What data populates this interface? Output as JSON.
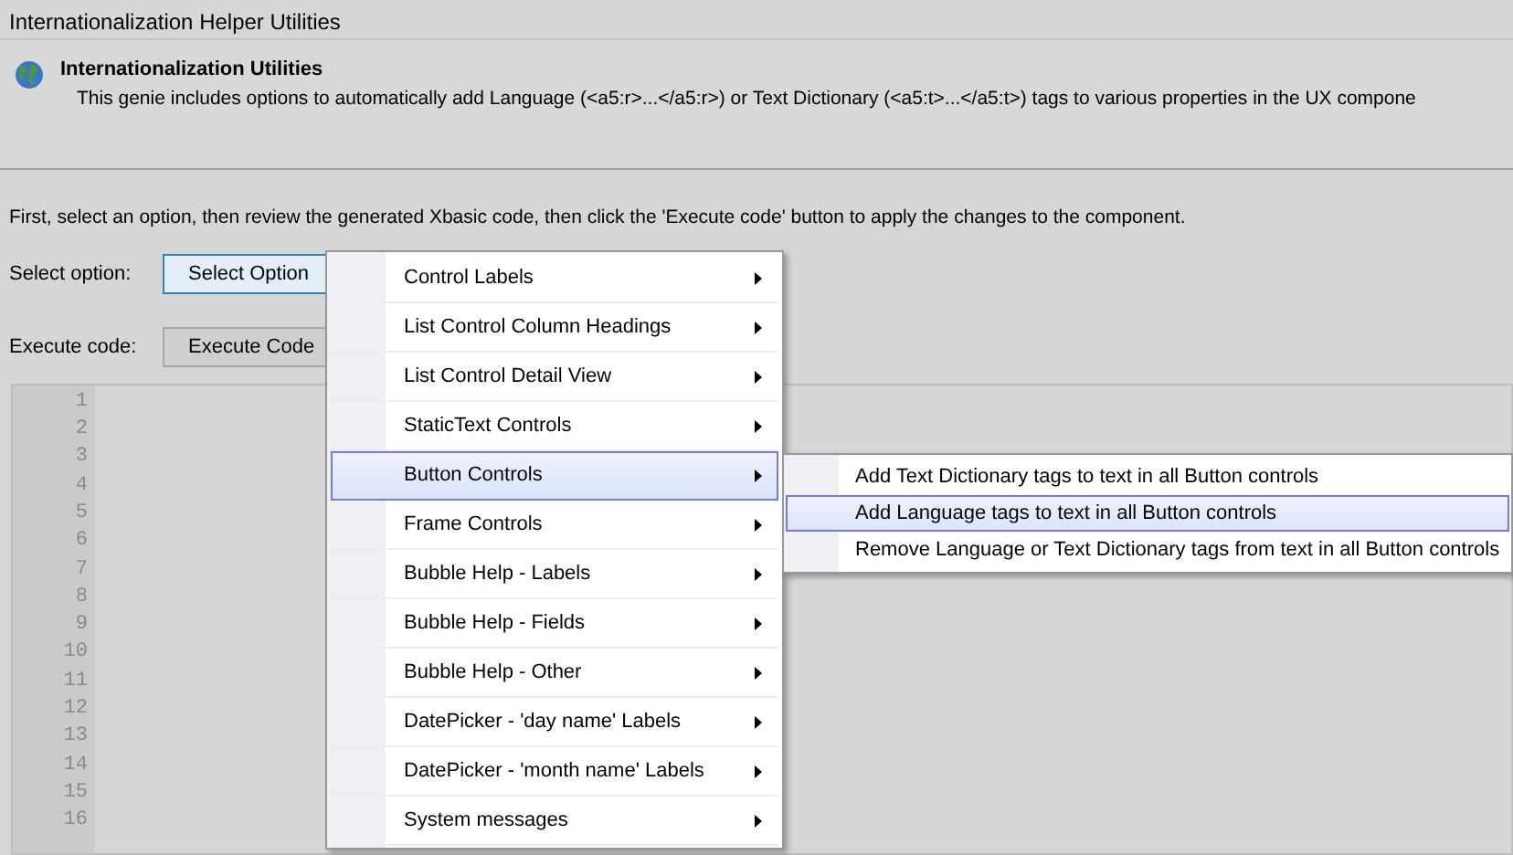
{
  "window": {
    "title": "Internationalization Helper Utilities"
  },
  "header": {
    "title": "Internationalization Utilities",
    "description": "This genie includes options to automatically add Language (<a5:r>...</a5:r>) or Text Dictionary (<a5:t>...</a5:t>)  tags to various properties in the UX compone"
  },
  "instructions": "First, select an option, then review the generated Xbasic code, then click the 'Execute code' button to apply the changes to the component.",
  "select_option": {
    "label": "Select option:",
    "button": "Select Option"
  },
  "execute_code": {
    "label": "Execute code:",
    "button": "Execute Code"
  },
  "editor": {
    "line_numbers": [
      "1",
      "2",
      "3",
      "4",
      "5",
      "6",
      "7",
      "8",
      "9",
      "10",
      "11",
      "12",
      "13",
      "14",
      "15",
      "16"
    ]
  },
  "menu": {
    "items": [
      {
        "label": "Control Labels",
        "selected": false
      },
      {
        "label": "List Control Column Headings",
        "selected": false
      },
      {
        "label": "List Control Detail View",
        "selected": false
      },
      {
        "label": "StaticText Controls",
        "selected": false
      },
      {
        "label": "Button Controls",
        "selected": true
      },
      {
        "label": "Frame Controls",
        "selected": false
      },
      {
        "label": "Bubble Help - Labels",
        "selected": false
      },
      {
        "label": "Bubble Help - Fields",
        "selected": false
      },
      {
        "label": "Bubble Help - Other",
        "selected": false
      },
      {
        "label": "DatePicker - 'day name' Labels",
        "selected": false
      },
      {
        "label": "DatePicker - 'month name' Labels",
        "selected": false
      },
      {
        "label": "System messages",
        "selected": false
      }
    ]
  },
  "submenu": {
    "items": [
      {
        "label": "Add Text Dictionary tags to text in all Button controls",
        "selected": false
      },
      {
        "label": "Add Language tags to text in all Button controls",
        "selected": true
      },
      {
        "label": "Remove Language or Text Dictionary tags from text in all Button controls",
        "selected": false
      }
    ]
  }
}
